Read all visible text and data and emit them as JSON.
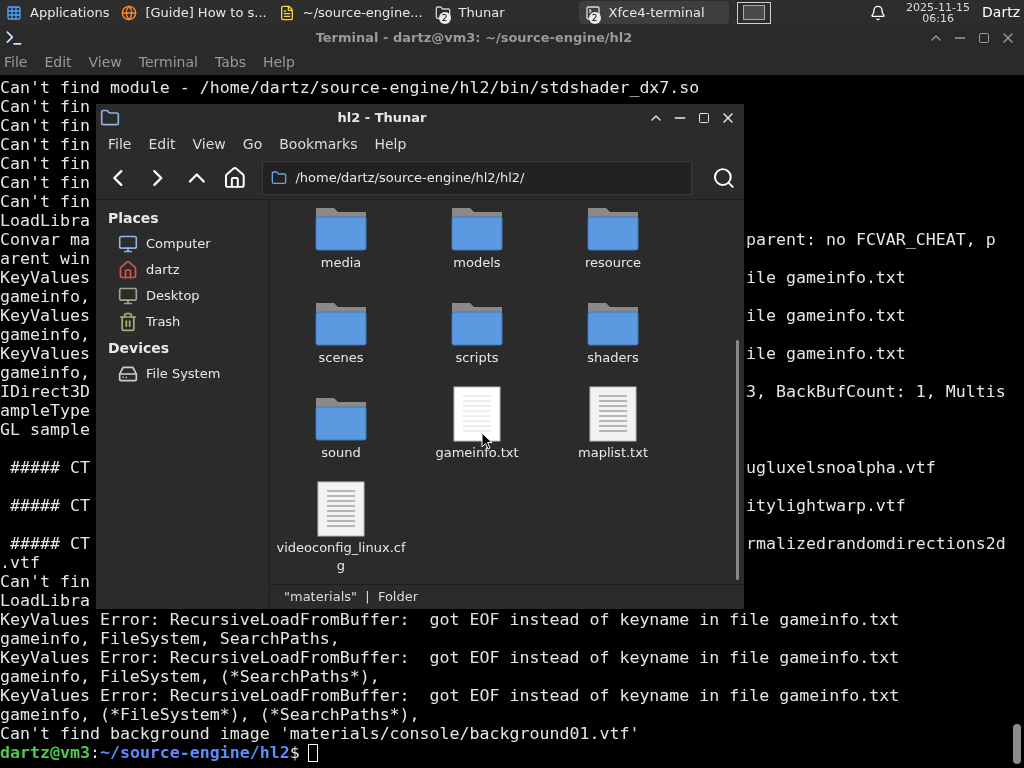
{
  "taskbar": {
    "items": [
      {
        "kind": "menu",
        "label": "Applications",
        "selected": false
      },
      {
        "kind": "browser",
        "label": "[Guide] How to s...",
        "selected": false
      },
      {
        "kind": "editor",
        "label": "~/source-engine...",
        "selected": false
      },
      {
        "kind": "files",
        "label": "Thunar",
        "badge": "2",
        "selected": false
      },
      {
        "kind": "terminal",
        "label": "Xfce4-terminal",
        "badge": "2",
        "selected": true
      }
    ],
    "date": "2025-11-15",
    "time": "06:16",
    "user": "Dartz"
  },
  "terminal": {
    "title": "Terminal - dartz@vm3: ~/source-engine/hl2",
    "menu": [
      "File",
      "Edit",
      "View",
      "Terminal",
      "Tabs",
      "Help"
    ],
    "lines": [
      {
        "kind": "full",
        "text": "Can't find module - /home/dartz/source-engine/hl2/bin/stdshader_dx7.so"
      },
      {
        "kind": "split",
        "left": "Can't fin"
      },
      {
        "kind": "split",
        "left": "Can't fin"
      },
      {
        "kind": "split",
        "left": "Can't fin"
      },
      {
        "kind": "split",
        "left": "Can't fin"
      },
      {
        "kind": "split",
        "left": "Can't fin"
      },
      {
        "kind": "split",
        "left": "Can't fin"
      },
      {
        "kind": "split",
        "left": "LoadLibra"
      },
      {
        "kind": "split",
        "left": "Convar ma",
        "right": "parent: no FCVAR_CHEAT, p"
      },
      {
        "kind": "split",
        "left": "arent win"
      },
      {
        "kind": "split",
        "left": "KeyValues",
        "right": "ile gameinfo.txt"
      },
      {
        "kind": "split",
        "left": "gameinfo,"
      },
      {
        "kind": "split",
        "left": "KeyValues",
        "right": "ile gameinfo.txt"
      },
      {
        "kind": "split",
        "left": "gameinfo,"
      },
      {
        "kind": "split",
        "left": "KeyValues",
        "right": "ile gameinfo.txt"
      },
      {
        "kind": "split",
        "left": "gameinfo,"
      },
      {
        "kind": "split",
        "left": "IDirect3D",
        "right": "3, BackBufCount: 1, Multis"
      },
      {
        "kind": "split",
        "left": "ampleType"
      },
      {
        "kind": "split",
        "left": "GL sample"
      },
      {
        "kind": "blank"
      },
      {
        "kind": "split",
        "left": " ##### CT",
        "right": "ugluxelsnoalpha.vtf"
      },
      {
        "kind": "blank"
      },
      {
        "kind": "split",
        "left": " ##### CT",
        "right": "itylightwarp.vtf"
      },
      {
        "kind": "blank"
      },
      {
        "kind": "split",
        "left": " ##### CT",
        "right": "rmalizedrandomdirections2d"
      },
      {
        "kind": "split",
        "left": ".vtf"
      },
      {
        "kind": "split",
        "left": "Can't fin"
      },
      {
        "kind": "split",
        "left": "LoadLibra"
      },
      {
        "kind": "full",
        "text": "KeyValues Error: RecursiveLoadFromBuffer:  got EOF instead of keyname in file gameinfo.txt"
      },
      {
        "kind": "full",
        "text": "gameinfo, FileSystem, SearchPaths,"
      },
      {
        "kind": "full",
        "text": "KeyValues Error: RecursiveLoadFromBuffer:  got EOF instead of keyname in file gameinfo.txt"
      },
      {
        "kind": "full",
        "text": "gameinfo, FileSystem, (*SearchPaths*),"
      },
      {
        "kind": "full",
        "text": "KeyValues Error: RecursiveLoadFromBuffer:  got EOF instead of keyname in file gameinfo.txt"
      },
      {
        "kind": "full",
        "text": "gameinfo, (*FileSystem*), (*SearchPaths*),"
      },
      {
        "kind": "full",
        "text": "Can't find background image 'materials/console/background01.vtf'"
      },
      {
        "kind": "prompt",
        "user": "dartz@vm3",
        "sep": ":",
        "path": "~/source-engine/hl2",
        "sign": "$"
      }
    ]
  },
  "thunar": {
    "title": "hl2 - Thunar",
    "menu": [
      "File",
      "Edit",
      "View",
      "Go",
      "Bookmarks",
      "Help"
    ],
    "path": "/home/dartz/source-engine/hl2/hl2/",
    "sidebar": [
      {
        "heading": "Places",
        "items": [
          {
            "kind": "computer",
            "label": "Computer"
          },
          {
            "kind": "home",
            "label": "dartz"
          },
          {
            "kind": "desktop",
            "label": "Desktop"
          },
          {
            "kind": "trash",
            "label": "Trash"
          }
        ]
      },
      {
        "heading": "Devices",
        "items": [
          {
            "kind": "drive",
            "label": "File System"
          }
        ]
      }
    ],
    "files": [
      {
        "kind": "folder",
        "name": "media"
      },
      {
        "kind": "folder",
        "name": "models"
      },
      {
        "kind": "folder",
        "name": "resource"
      },
      {
        "kind": "folder",
        "name": "scenes"
      },
      {
        "kind": "folder",
        "name": "scripts"
      },
      {
        "kind": "folder",
        "name": "shaders"
      },
      {
        "kind": "folder",
        "name": "sound"
      },
      {
        "kind": "file",
        "name": "gameinfo.txt",
        "hovered": true
      },
      {
        "kind": "file",
        "name": "maplist.txt"
      },
      {
        "kind": "file",
        "name": "videoconfig_linux.cfg"
      }
    ],
    "status": "\"materials\"  |  Folder"
  }
}
